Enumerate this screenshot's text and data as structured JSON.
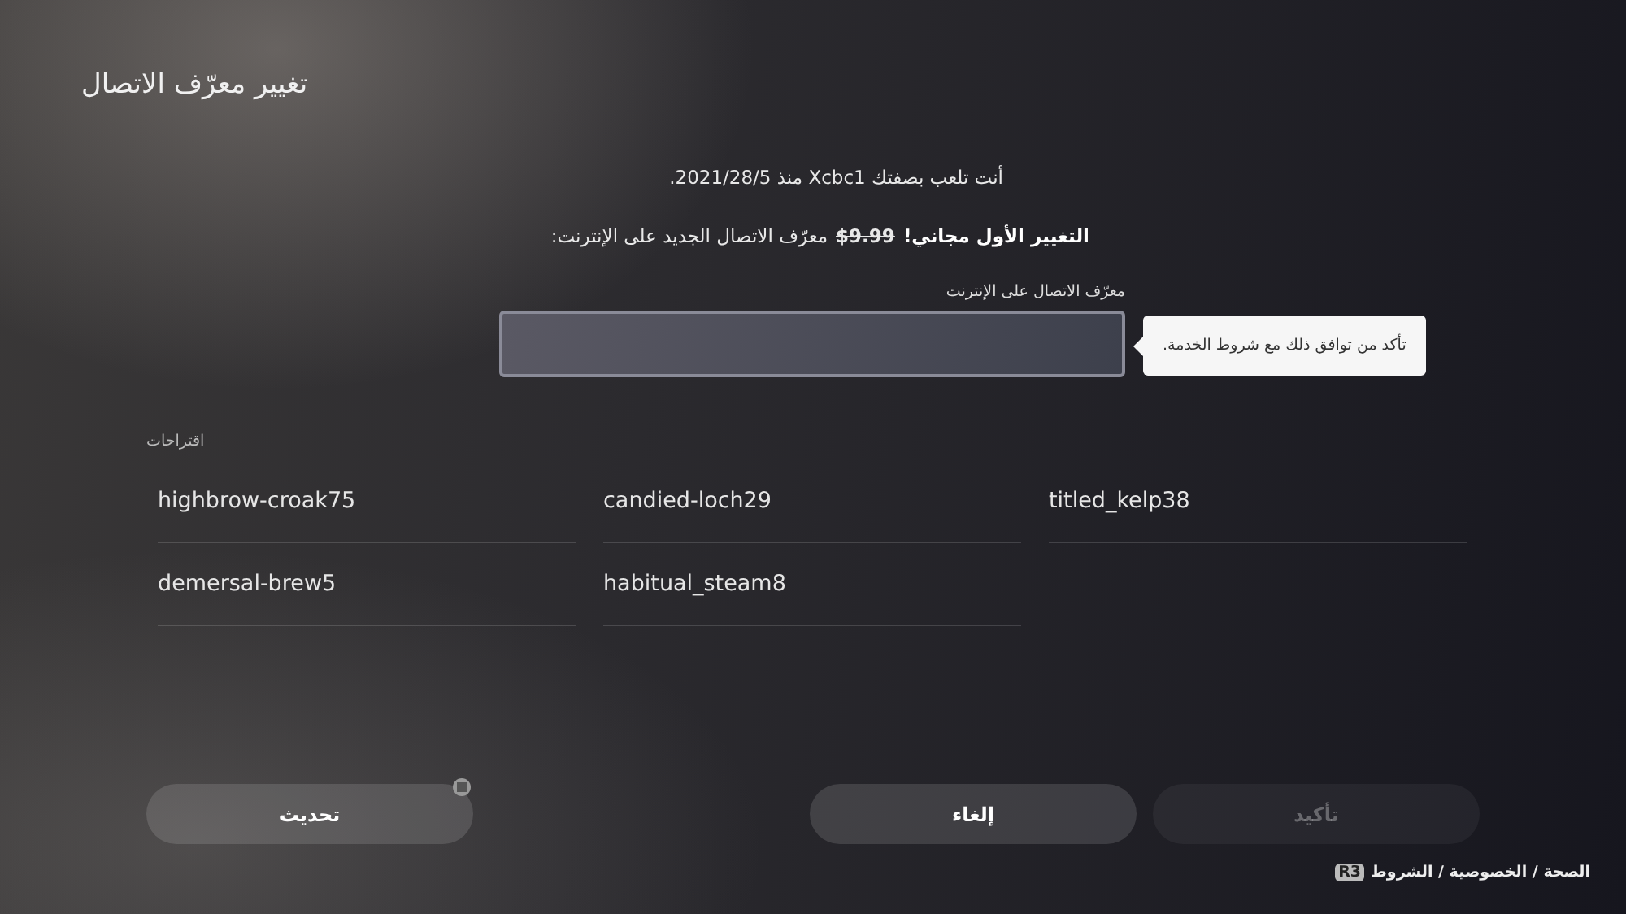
{
  "header": {
    "title": "تغيير معرّف الاتصال"
  },
  "status_line": "أنت تلعب بصفتك Xcbc1 منذ 2021/28/5.",
  "price_line": {
    "free_note": "التغيير الأول مجاني!",
    "old_price": "$9.99",
    "label": "معرّف الاتصال الجديد على الإنترنت:"
  },
  "id_field": {
    "label": "معرّف الاتصال على الإنترنت"
  },
  "tooltip": "تأكد من توافق ذلك مع شروط الخدمة.",
  "suggestions": {
    "label": "اقتراحات",
    "items": [
      {
        "text": "titled_kelp38"
      },
      {
        "text": "candied-loch29"
      },
      {
        "text": "highbrow-croak75"
      },
      {
        "text": "habitual_steam8"
      },
      {
        "text": "demersal-brew5"
      }
    ]
  },
  "buttons": [
    {
      "label": "تأكيد",
      "kind": "confirm",
      "disabled": true
    },
    {
      "label": "إلغاء",
      "kind": "cancel",
      "disabled": false
    },
    {
      "label": "تحديث",
      "kind": "refresh",
      "disabled": false
    }
  ],
  "footer": {
    "button_glyph": "R3",
    "links": "الصحة / الخصوصية / الشروط"
  }
}
